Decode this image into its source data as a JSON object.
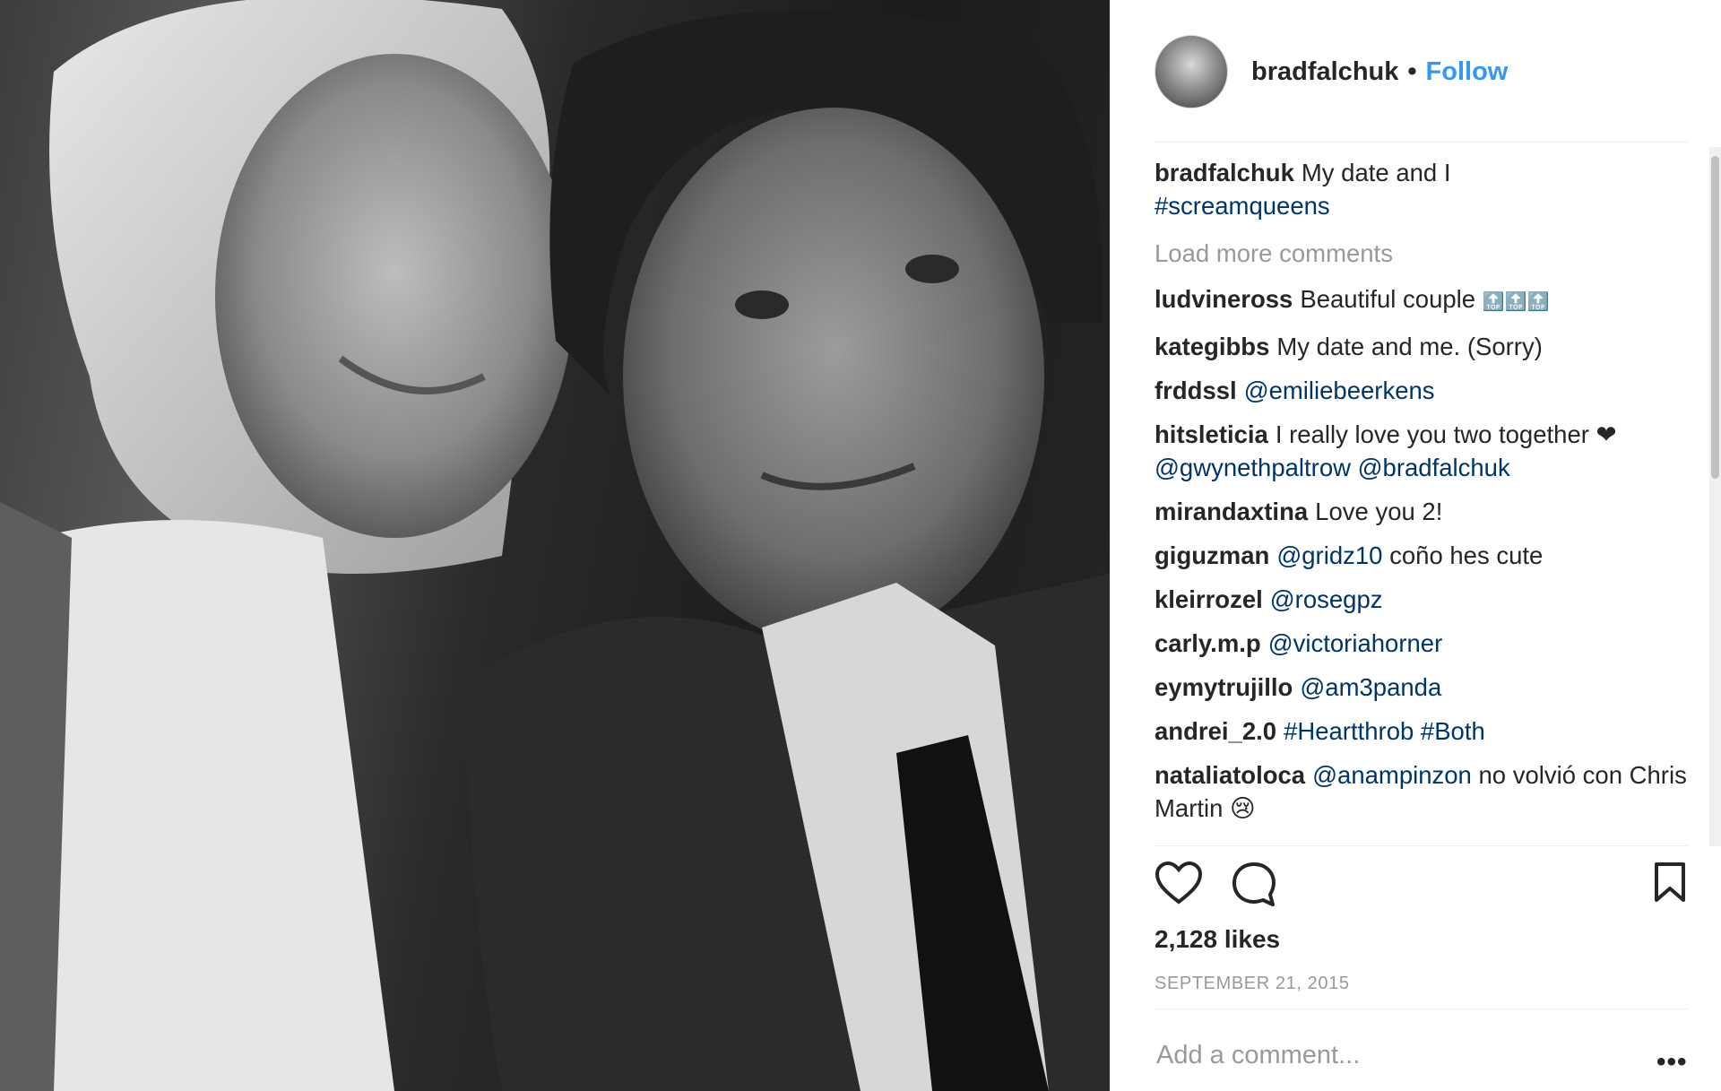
{
  "post": {
    "username": "bradfalchuk",
    "separator": "•",
    "follow_label": "Follow",
    "caption": {
      "user": "bradfalchuk",
      "text": "My date and I",
      "hashtag": "#screamqueens"
    },
    "load_more": "Load more comments",
    "comments": [
      {
        "user": "ludvineross",
        "text": "Beautiful couple",
        "emoji": "🔝🔝🔝"
      },
      {
        "user": "kategibbs",
        "text": "My date and me. (Sorry)"
      },
      {
        "user": "frddssl",
        "mention": "@emiliebeerkens"
      },
      {
        "user": "hitsleticia",
        "text": "I really love you two together ❤",
        "mention": "@gwynethpaltrow @bradfalchuk"
      },
      {
        "user": "mirandaxtina",
        "text": "Love you 2!"
      },
      {
        "user": "giguzman",
        "mention": "@gridz10",
        "text": "coño hes cute"
      },
      {
        "user": "kleirrozel",
        "mention": "@rosegpz"
      },
      {
        "user": "carly.m.p",
        "mention": "@victoriahorner"
      },
      {
        "user": "eymytrujillo",
        "mention": "@am3panda"
      },
      {
        "user": "andrei_2.0",
        "mention": "#Heartthrob #Both"
      },
      {
        "user": "nataliatoloca",
        "mention": "@anampinzon",
        "text": "no volvió con Chris Martin 😢"
      }
    ],
    "likes": "2,128 likes",
    "date": "SEPTEMBER 21, 2015",
    "add_comment_placeholder": "Add a comment...",
    "more_label": "•••",
    "icons": [
      "heart-icon",
      "comment-icon",
      "bookmark-icon",
      "more-options-icon"
    ],
    "colors": {
      "link": "#3897f0",
      "mention": "#003569",
      "muted": "#999999",
      "text": "#262626"
    }
  }
}
